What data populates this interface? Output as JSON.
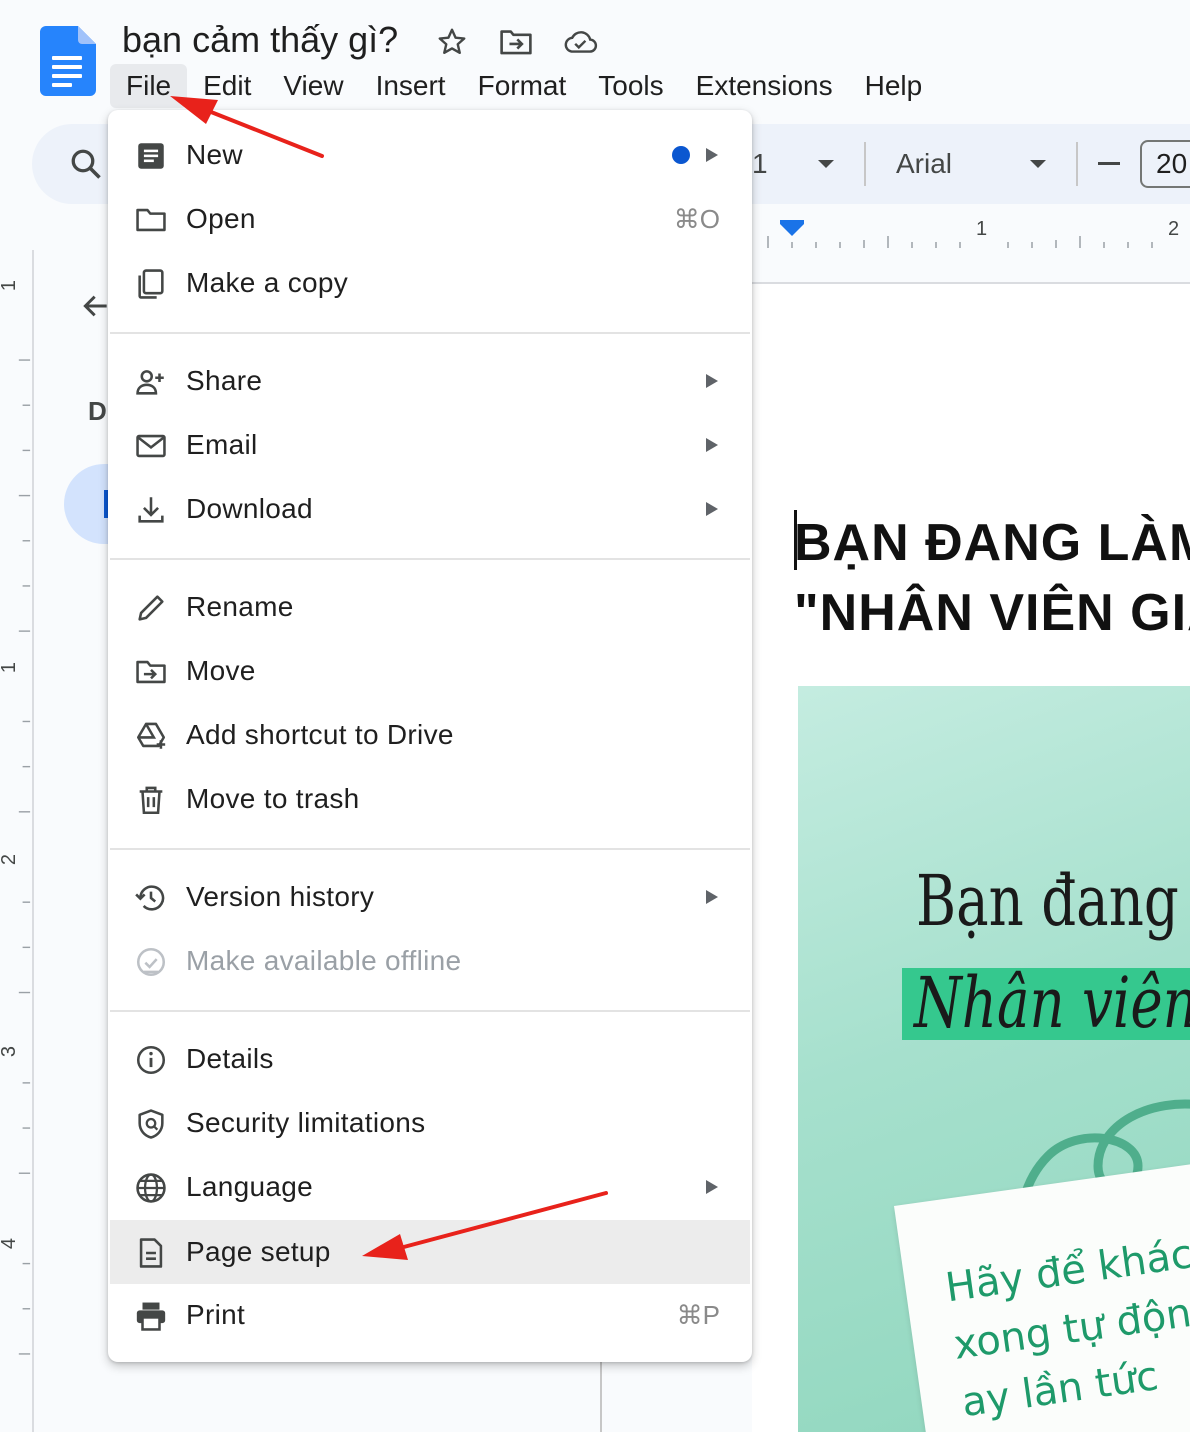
{
  "document": {
    "title": "bạn cảm thấy gì?",
    "heading_line1": "BẠN ĐANG LÀM",
    "heading_line2": "\"NHÂN VIÊN GIẢ",
    "image_line1": "Bạn đang l",
    "image_line2": "Nhân viên",
    "image_note_line1": "Hãy để khác",
    "image_note_line2": "xong tự động",
    "image_note_line3": "ay lần tức"
  },
  "menubar": {
    "items": [
      {
        "label": "File",
        "active": true
      },
      {
        "label": "Edit"
      },
      {
        "label": "View"
      },
      {
        "label": "Insert"
      },
      {
        "label": "Format"
      },
      {
        "label": "Tools"
      },
      {
        "label": "Extensions"
      },
      {
        "label": "Help"
      }
    ]
  },
  "toolbar": {
    "zoom_partial": "1",
    "font": "Arial",
    "font_size": "20"
  },
  "ruler": {
    "top_marks": [
      "1",
      "2"
    ],
    "left_marks": [
      "1",
      "1",
      "2",
      "3",
      "4"
    ]
  },
  "outline": {
    "letter": "D"
  },
  "file_menu": {
    "items": [
      {
        "label": "New",
        "icon": "doc-icon",
        "submenu": true,
        "dot": true
      },
      {
        "label": "Open",
        "icon": "folder-icon",
        "shortcut": "⌘O"
      },
      {
        "label": "Make a copy",
        "icon": "copy-icon"
      },
      {
        "label": "Share",
        "icon": "person-add-icon",
        "submenu": true
      },
      {
        "label": "Email",
        "icon": "mail-icon",
        "submenu": true
      },
      {
        "label": "Download",
        "icon": "download-icon",
        "submenu": true
      },
      {
        "label": "Rename",
        "icon": "pencil-icon"
      },
      {
        "label": "Move",
        "icon": "move-folder-icon"
      },
      {
        "label": "Add shortcut to Drive",
        "icon": "drive-shortcut-icon"
      },
      {
        "label": "Move to trash",
        "icon": "trash-icon"
      },
      {
        "label": "Version history",
        "icon": "history-icon",
        "submenu": true
      },
      {
        "label": "Make available offline",
        "icon": "offline-check-icon",
        "disabled": true
      },
      {
        "label": "Details",
        "icon": "info-icon"
      },
      {
        "label": "Security limitations",
        "icon": "shield-icon"
      },
      {
        "label": "Language",
        "icon": "globe-icon",
        "submenu": true
      },
      {
        "label": "Page setup",
        "icon": "page-setup-icon",
        "highlighted": true
      },
      {
        "label": "Print",
        "icon": "printer-icon",
        "shortcut": "⌘P"
      }
    ]
  },
  "colors": {
    "accent": "#0b57d0",
    "docs_blue": "#2684fc",
    "annotation_red": "#e8221b",
    "menu_highlight": "#ececec"
  }
}
